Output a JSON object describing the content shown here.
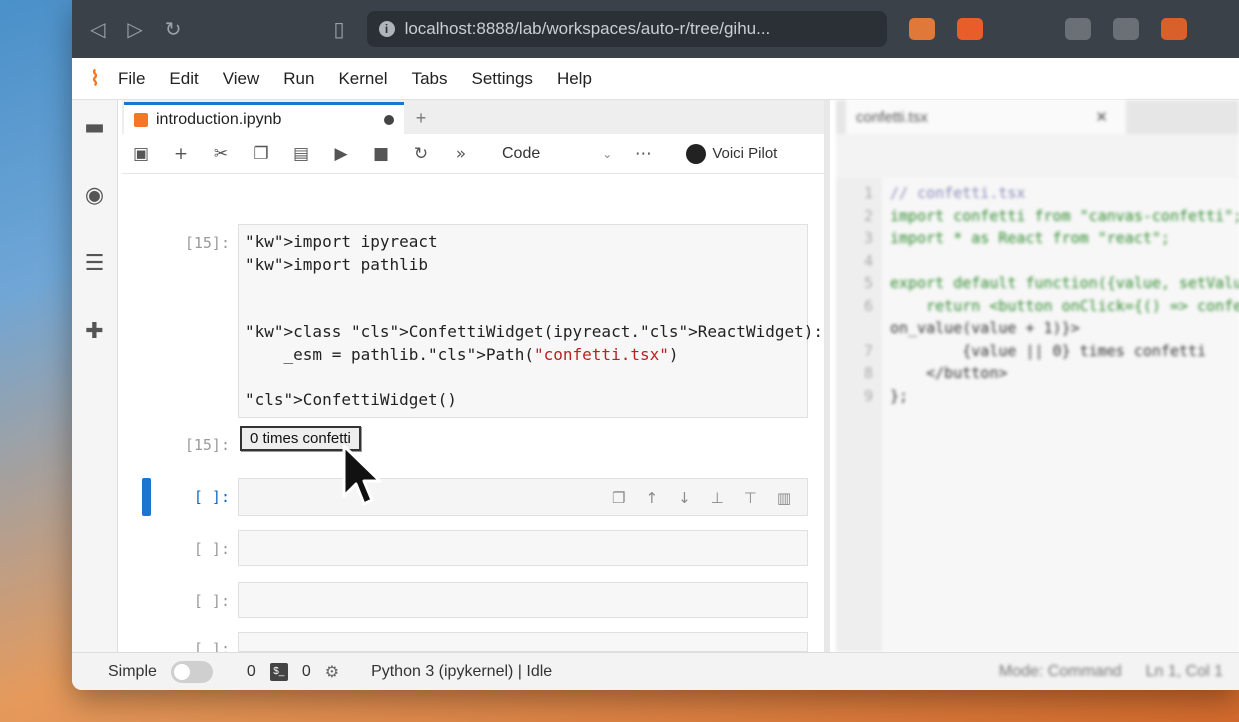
{
  "browser": {
    "url": "localhost:8888/lab/workspaces/auto-r/tree/gihu..."
  },
  "menu": [
    "File",
    "Edit",
    "View",
    "Run",
    "Kernel",
    "Tabs",
    "Settings",
    "Help"
  ],
  "notebook_tab": {
    "title": "introduction.ipynb",
    "plus": "+"
  },
  "toolbar": {
    "cell_type": "Code",
    "voici_label": "Voici Pilot"
  },
  "cells": [
    {
      "prompt": "[15]:",
      "code_lines": [
        "import ipyreact",
        "import pathlib",
        "",
        "",
        "class ConfettiWidget(ipyreact.ReactWidget):",
        "    _esm = pathlib.Path(\"confetti.tsx\")",
        "",
        "ConfettiWidget()"
      ]
    },
    {
      "prompt": "[15]:",
      "output_button": "0 times confetti"
    },
    {
      "prompt": "[ ]:"
    },
    {
      "prompt": "[ ]:"
    },
    {
      "prompt": "[ ]:"
    },
    {
      "prompt": "[ ]:"
    }
  ],
  "right_panel": {
    "tab_title": "confetti.tsx",
    "lines": [
      {
        "n": "1",
        "t": "// confetti.tsx"
      },
      {
        "n": "2",
        "t": "import confetti from \"canvas-confetti\";"
      },
      {
        "n": "3",
        "t": "import * as React from \"react\";"
      },
      {
        "n": "4",
        "t": ""
      },
      {
        "n": "5",
        "t": "export default function({value, setValue}) {"
      },
      {
        "n": "6",
        "t": "    return <button onClick={() => confetti() &&"
      },
      {
        "n": "",
        "t": "on_value(value + 1)}>"
      },
      {
        "n": "7",
        "t": "        {value || 0} times confetti"
      },
      {
        "n": "8",
        "t": "    </button>"
      },
      {
        "n": "9",
        "t": "};"
      }
    ]
  },
  "status": {
    "mode": "Simple",
    "count_a": "0",
    "count_b": "0",
    "kernel": "Python 3 (ipykernel) | Idle",
    "edit_mode": "Mode: Command",
    "position": "Ln 1, Col 1"
  }
}
